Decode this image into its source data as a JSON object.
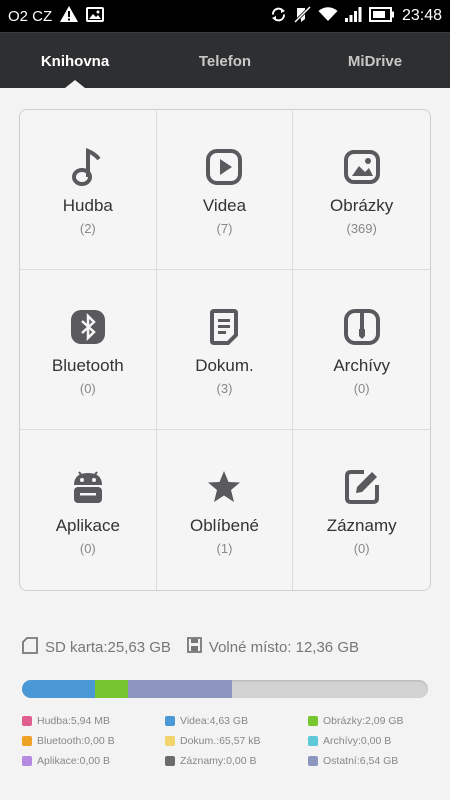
{
  "status_bar": {
    "carrier": "O2 CZ",
    "time": "23:48",
    "icons": [
      "warning-icon",
      "image-icon",
      "sync-icon",
      "mute-icon",
      "wifi-icon",
      "signal-icon",
      "battery-icon"
    ]
  },
  "tabs": [
    {
      "label": "Knihovna",
      "active": true
    },
    {
      "label": "Telefon",
      "active": false
    },
    {
      "label": "MiDrive",
      "active": false
    }
  ],
  "categories": [
    {
      "label": "Hudba",
      "count": "(2)",
      "icon": "music-note-icon"
    },
    {
      "label": "Videa",
      "count": "(7)",
      "icon": "play-icon"
    },
    {
      "label": "Obrázky",
      "count": "(369)",
      "icon": "picture-icon"
    },
    {
      "label": "Bluetooth",
      "count": "(0)",
      "icon": "bluetooth-icon"
    },
    {
      "label": "Dokum.",
      "count": "(3)",
      "icon": "document-icon"
    },
    {
      "label": "Archívy",
      "count": "(0)",
      "icon": "archive-icon"
    },
    {
      "label": "Aplikace",
      "count": "(0)",
      "icon": "android-icon"
    },
    {
      "label": "Oblíbené",
      "count": "(1)",
      "icon": "star-icon"
    },
    {
      "label": "Záznamy",
      "count": "(0)",
      "icon": "edit-icon"
    }
  ],
  "storage": {
    "sd_card": "SD karta:25,63 GB",
    "free_space": "Volné místo: 12,36 GB",
    "bar_segments": [
      {
        "name": "Videa",
        "fraction": 0.181,
        "color": "#4a98d6"
      },
      {
        "name": "Obrázky",
        "fraction": 0.081,
        "color": "#77c52f"
      },
      {
        "name": "Ostatní",
        "fraction": 0.255,
        "color": "#8c96bf"
      }
    ],
    "legend": [
      {
        "text": "Hudba:5,94 MB",
        "color": "#e05f8f"
      },
      {
        "text": "Videa:4,63 GB",
        "color": "#4a98d6"
      },
      {
        "text": "Obrázky:2,09 GB",
        "color": "#77c52f"
      },
      {
        "text": "Bluetooth:0,00 B",
        "color": "#f0a227"
      },
      {
        "text": "Dokum.:65,57 kB",
        "color": "#f1d46b"
      },
      {
        "text": "Archívy:0,00 B",
        "color": "#5cc8d8"
      },
      {
        "text": "Aplikace:0,00 B",
        "color": "#b38ae0"
      },
      {
        "text": "Záznamy:0,00 B",
        "color": "#6b6b6b"
      },
      {
        "text": "Ostatní:6,54 GB",
        "color": "#8c96bf"
      }
    ]
  },
  "colors": {
    "icon": "#5a5a5e",
    "tabbar": "#2e2f31"
  }
}
